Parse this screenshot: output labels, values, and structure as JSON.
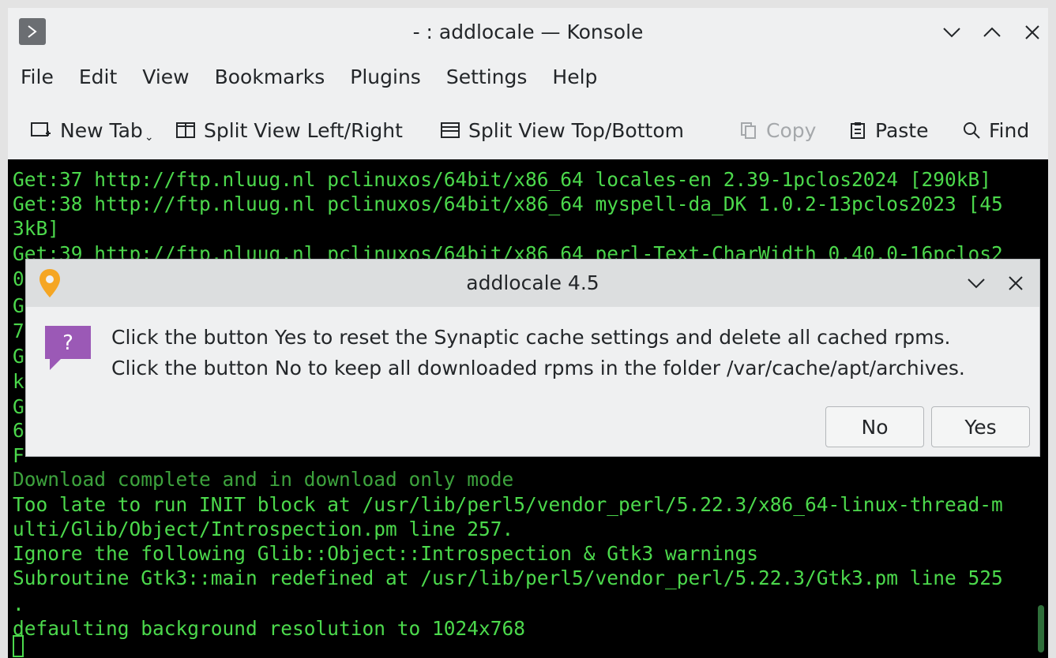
{
  "window": {
    "title": "- : addlocale — Konsole"
  },
  "menubar": {
    "items": [
      "File",
      "Edit",
      "View",
      "Bookmarks",
      "Plugins",
      "Settings",
      "Help"
    ]
  },
  "toolbar": {
    "new_tab": "New Tab",
    "split_lr": "Split View Left/Right",
    "split_tb": "Split View Top/Bottom",
    "copy": "Copy",
    "paste": "Paste",
    "find": "Find"
  },
  "terminal": {
    "lines": [
      "Get:37 http://ftp.nluug.nl pclinuxos/64bit/x86_64 locales-en 2.39-1pclos2024 [290kB]",
      "Get:38 http://ftp.nluug.nl pclinuxos/64bit/x86_64 myspell-da_DK 1.0.2-13pclos2023 [45",
      "3kB]",
      "Get:39 http://ftp.nluug.nl pclinuxos/64bit/x86_64 perl-Text-CharWidth 0.40.0-16pclos2",
      "0",
      "G",
      "7",
      "G",
      "k",
      "G",
      "6",
      "F",
      "Download complete and in download only mode",
      "Too late to run INIT block at /usr/lib/perl5/vendor_perl/5.22.3/x86_64-linux-thread-m",
      "ulti/Glib/Object/Introspection.pm line 257.",
      "Ignore the following Glib::Object::Introspection & Gtk3 warnings",
      "Subroutine Gtk3::main redefined at /usr/lib/perl5/vendor_perl/5.22.3/Gtk3.pm line 525",
      ".",
      "defaulting background resolution to 1024x768"
    ]
  },
  "dialog": {
    "title": "addlocale 4.5",
    "message_line1": "Click the button Yes to reset the Synaptic cache settings and delete all cached rpms.",
    "message_line2": "Click the button No to keep all downloaded rpms in the folder /var/cache/apt/archives.",
    "no_label": "No",
    "yes_label": "Yes"
  },
  "colors": {
    "terminal_bg": "#000000",
    "terminal_text": "#4cd94c",
    "chrome": "#eff0f1",
    "question_icon": "#9b59b6",
    "app_marker": "#f5a623"
  },
  "icons": {
    "app": "terminal-prompt-icon",
    "dialog_app": "location-pin-icon",
    "question": "question-bubble-icon"
  }
}
